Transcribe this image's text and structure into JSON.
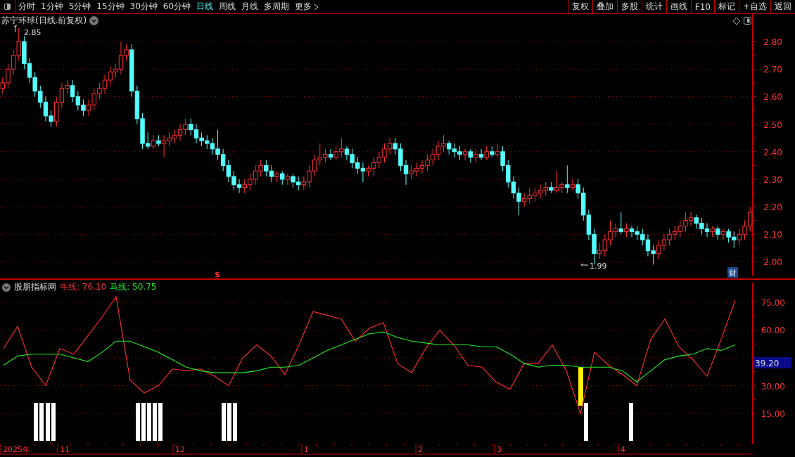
{
  "toolbar": {
    "periods": [
      {
        "label": "分时",
        "selected": false
      },
      {
        "label": "1分钟",
        "selected": false
      },
      {
        "label": "5分钟",
        "selected": false
      },
      {
        "label": "15分钟",
        "selected": false
      },
      {
        "label": "30分钟",
        "selected": false
      },
      {
        "label": "60分钟",
        "selected": false
      },
      {
        "label": "日线",
        "selected": true
      },
      {
        "label": "周线",
        "selected": false
      },
      {
        "label": "月线",
        "selected": false
      },
      {
        "label": "多周期",
        "selected": false
      },
      {
        "label": "更多",
        "selected": false
      }
    ],
    "actions": [
      "复权",
      "叠加",
      "多股",
      "统计",
      "画线",
      "F10",
      "标记",
      "+自选",
      "返回"
    ]
  },
  "price_chart": {
    "title": "苏宁环球(日线.前复权)",
    "high_marker": "2.85",
    "low_marker": "1.99",
    "event_marker": "$",
    "finance_badge": "财",
    "chart_data": {
      "type": "candlestick",
      "categories": [
        null,
        null,
        null,
        null,
        null,
        null,
        null,
        null,
        null,
        null,
        null,
        null,
        null,
        null,
        null,
        null,
        null,
        null,
        null,
        null,
        null,
        null,
        null,
        null,
        null,
        null,
        null,
        null,
        null,
        null,
        null,
        null,
        null,
        null,
        null,
        null,
        null,
        null,
        null,
        null,
        null,
        null,
        null,
        null,
        null,
        null,
        null,
        null,
        null,
        null,
        null,
        null,
        null,
        null,
        null,
        null,
        null,
        null,
        null,
        null,
        null,
        null,
        null,
        null,
        null,
        null,
        null,
        null,
        null,
        null,
        null,
        null,
        null,
        null,
        null,
        null,
        null,
        null,
        null,
        null,
        null,
        null,
        null,
        null,
        null,
        null,
        null,
        null,
        null,
        null,
        null,
        null,
        null,
        null,
        null,
        null,
        null,
        null,
        null,
        null,
        null,
        null,
        null,
        null,
        null,
        null,
        null,
        null,
        null,
        null,
        null,
        null,
        null,
        null,
        null,
        null,
        null,
        null,
        null,
        null,
        null,
        null,
        null,
        null,
        null,
        null,
        null,
        null,
        null,
        null,
        null,
        null,
        null,
        null,
        null,
        null,
        null,
        null,
        null,
        null
      ],
      "ylim": [
        1.95,
        2.9
      ],
      "grid": true,
      "yticks": [
        {
          "value": 2.8,
          "label": "2.80"
        },
        {
          "value": 2.7,
          "label": "2.70"
        },
        {
          "value": 2.6,
          "label": "2.60"
        },
        {
          "value": 2.5,
          "label": "2.50"
        },
        {
          "value": 2.4,
          "label": "2.40"
        },
        {
          "value": 2.3,
          "label": "2.30"
        },
        {
          "value": 2.2,
          "label": "2.20"
        },
        {
          "value": 2.1,
          "label": "2.10"
        },
        {
          "value": 2.0,
          "label": "2.00"
        }
      ],
      "ohlc": [
        [
          2.63,
          2.67,
          2.61,
          2.65
        ],
        [
          2.65,
          2.72,
          2.63,
          2.7
        ],
        [
          2.7,
          2.77,
          2.68,
          2.75
        ],
        [
          2.75,
          2.85,
          2.73,
          2.8
        ],
        [
          2.8,
          2.82,
          2.7,
          2.72
        ],
        [
          2.72,
          2.74,
          2.65,
          2.67
        ],
        [
          2.67,
          2.69,
          2.6,
          2.62
        ],
        [
          2.62,
          2.64,
          2.56,
          2.58
        ],
        [
          2.58,
          2.6,
          2.51,
          2.53
        ],
        [
          2.53,
          2.55,
          2.49,
          2.51
        ],
        [
          2.51,
          2.6,
          2.49,
          2.58
        ],
        [
          2.58,
          2.65,
          2.56,
          2.63
        ],
        [
          2.63,
          2.66,
          2.61,
          2.64
        ],
        [
          2.64,
          2.66,
          2.58,
          2.6
        ],
        [
          2.6,
          2.62,
          2.55,
          2.57
        ],
        [
          2.57,
          2.59,
          2.53,
          2.55
        ],
        [
          2.55,
          2.59,
          2.53,
          2.57
        ],
        [
          2.57,
          2.63,
          2.55,
          2.61
        ],
        [
          2.61,
          2.65,
          2.59,
          2.63
        ],
        [
          2.63,
          2.68,
          2.61,
          2.66
        ],
        [
          2.66,
          2.71,
          2.64,
          2.69
        ],
        [
          2.69,
          2.72,
          2.67,
          2.7
        ],
        [
          2.7,
          2.8,
          2.68,
          2.75
        ],
        [
          2.75,
          2.79,
          2.73,
          2.77
        ],
        [
          2.77,
          2.79,
          2.6,
          2.62
        ],
        [
          2.62,
          2.64,
          2.5,
          2.52
        ],
        [
          2.52,
          2.54,
          2.41,
          2.43
        ],
        [
          2.43,
          2.47,
          2.41,
          2.42
        ],
        [
          2.42,
          2.46,
          2.41,
          2.44
        ],
        [
          2.44,
          2.46,
          2.42,
          2.43
        ],
        [
          2.43,
          2.46,
          2.38,
          2.44
        ],
        [
          2.44,
          2.47,
          2.42,
          2.45
        ],
        [
          2.45,
          2.48,
          2.43,
          2.46
        ],
        [
          2.46,
          2.5,
          2.44,
          2.48
        ],
        [
          2.48,
          2.52,
          2.46,
          2.5
        ],
        [
          2.5,
          2.52,
          2.46,
          2.48
        ],
        [
          2.48,
          2.5,
          2.43,
          2.45
        ],
        [
          2.45,
          2.47,
          2.42,
          2.44
        ],
        [
          2.44,
          2.46,
          2.41,
          2.43
        ],
        [
          2.43,
          2.45,
          2.39,
          2.41
        ],
        [
          2.41,
          2.48,
          2.37,
          2.39
        ],
        [
          2.39,
          2.41,
          2.33,
          2.35
        ],
        [
          2.35,
          2.37,
          2.29,
          2.31
        ],
        [
          2.31,
          2.33,
          2.26,
          2.28
        ],
        [
          2.28,
          2.3,
          2.25,
          2.27
        ],
        [
          2.27,
          2.3,
          2.25,
          2.28
        ],
        [
          2.28,
          2.32,
          2.26,
          2.3
        ],
        [
          2.3,
          2.35,
          2.28,
          2.33
        ],
        [
          2.33,
          2.37,
          2.31,
          2.35
        ],
        [
          2.35,
          2.37,
          2.31,
          2.33
        ],
        [
          2.33,
          2.35,
          2.29,
          2.31
        ],
        [
          2.31,
          2.33,
          2.29,
          2.32
        ],
        [
          2.32,
          2.33,
          2.28,
          2.3
        ],
        [
          2.3,
          2.32,
          2.28,
          2.31
        ],
        [
          2.31,
          2.32,
          2.27,
          2.29
        ],
        [
          2.29,
          2.31,
          2.26,
          2.28
        ],
        [
          2.28,
          2.31,
          2.26,
          2.29
        ],
        [
          2.29,
          2.35,
          2.27,
          2.33
        ],
        [
          2.33,
          2.39,
          2.31,
          2.37
        ],
        [
          2.37,
          2.43,
          2.35,
          2.38
        ],
        [
          2.38,
          2.41,
          2.36,
          2.39
        ],
        [
          2.39,
          2.41,
          2.37,
          2.38
        ],
        [
          2.38,
          2.42,
          2.37,
          2.4
        ],
        [
          2.4,
          2.45,
          2.38,
          2.41
        ],
        [
          2.41,
          2.42,
          2.37,
          2.39
        ],
        [
          2.39,
          2.41,
          2.34,
          2.36
        ],
        [
          2.36,
          2.38,
          2.32,
          2.34
        ],
        [
          2.34,
          2.36,
          2.29,
          2.33
        ],
        [
          2.33,
          2.35,
          2.31,
          2.34
        ],
        [
          2.34,
          2.38,
          2.31,
          2.36
        ],
        [
          2.36,
          2.4,
          2.34,
          2.38
        ],
        [
          2.38,
          2.43,
          2.36,
          2.41
        ],
        [
          2.41,
          2.45,
          2.39,
          2.43
        ],
        [
          2.43,
          2.45,
          2.39,
          2.41
        ],
        [
          2.41,
          2.43,
          2.33,
          2.35
        ],
        [
          2.35,
          2.37,
          2.28,
          2.32
        ],
        [
          2.32,
          2.35,
          2.3,
          2.33
        ],
        [
          2.33,
          2.36,
          2.31,
          2.34
        ],
        [
          2.34,
          2.37,
          2.32,
          2.35
        ],
        [
          2.35,
          2.39,
          2.33,
          2.37
        ],
        [
          2.37,
          2.41,
          2.35,
          2.39
        ],
        [
          2.39,
          2.44,
          2.37,
          2.42
        ],
        [
          2.42,
          2.46,
          2.4,
          2.43
        ],
        [
          2.43,
          2.44,
          2.39,
          2.41
        ],
        [
          2.41,
          2.43,
          2.38,
          2.4
        ],
        [
          2.4,
          2.42,
          2.37,
          2.39
        ],
        [
          2.39,
          2.41,
          2.37,
          2.4
        ],
        [
          2.4,
          2.41,
          2.36,
          2.38
        ],
        [
          2.38,
          2.41,
          2.36,
          2.39
        ],
        [
          2.39,
          2.41,
          2.37,
          2.38
        ],
        [
          2.38,
          2.42,
          2.37,
          2.4
        ],
        [
          2.4,
          2.42,
          2.38,
          2.39
        ],
        [
          2.39,
          2.43,
          2.38,
          2.4
        ],
        [
          2.4,
          2.42,
          2.33,
          2.35
        ],
        [
          2.35,
          2.37,
          2.27,
          2.29
        ],
        [
          2.29,
          2.31,
          2.23,
          2.25
        ],
        [
          2.25,
          2.27,
          2.17,
          2.22
        ],
        [
          2.22,
          2.25,
          2.2,
          2.23
        ],
        [
          2.23,
          2.27,
          2.21,
          2.24
        ],
        [
          2.24,
          2.27,
          2.22,
          2.25
        ],
        [
          2.25,
          2.28,
          2.23,
          2.26
        ],
        [
          2.26,
          2.29,
          2.24,
          2.27
        ],
        [
          2.27,
          2.29,
          2.25,
          2.26
        ],
        [
          2.26,
          2.33,
          2.25,
          2.27
        ],
        [
          2.27,
          2.29,
          2.25,
          2.28
        ],
        [
          2.28,
          2.35,
          2.25,
          2.27
        ],
        [
          2.27,
          2.3,
          2.26,
          2.28
        ],
        [
          2.28,
          2.3,
          2.23,
          2.25
        ],
        [
          2.25,
          2.27,
          2.15,
          2.17
        ],
        [
          2.17,
          2.19,
          2.08,
          2.1
        ],
        [
          2.1,
          2.12,
          1.99,
          2.03
        ],
        [
          2.03,
          2.07,
          2.01,
          2.04
        ],
        [
          2.04,
          2.1,
          2.02,
          2.08
        ],
        [
          2.08,
          2.15,
          2.06,
          2.11
        ],
        [
          2.11,
          2.14,
          2.09,
          2.12
        ],
        [
          2.12,
          2.18,
          2.1,
          2.11
        ],
        [
          2.11,
          2.14,
          2.09,
          2.12
        ],
        [
          2.12,
          2.13,
          2.09,
          2.11
        ],
        [
          2.11,
          2.13,
          2.08,
          2.1
        ],
        [
          2.1,
          2.12,
          2.06,
          2.08
        ],
        [
          2.08,
          2.1,
          2.02,
          2.04
        ],
        [
          2.04,
          2.06,
          1.99,
          2.03
        ],
        [
          2.03,
          2.08,
          2.01,
          2.06
        ],
        [
          2.06,
          2.1,
          2.04,
          2.08
        ],
        [
          2.08,
          2.12,
          2.06,
          2.1
        ],
        [
          2.1,
          2.13,
          2.08,
          2.11
        ],
        [
          2.11,
          2.15,
          2.09,
          2.13
        ],
        [
          2.13,
          2.18,
          2.11,
          2.15
        ],
        [
          2.15,
          2.18,
          2.13,
          2.16
        ],
        [
          2.16,
          2.17,
          2.12,
          2.14
        ],
        [
          2.14,
          2.16,
          2.1,
          2.12
        ],
        [
          2.12,
          2.14,
          2.09,
          2.11
        ],
        [
          2.11,
          2.13,
          2.09,
          2.12
        ],
        [
          2.12,
          2.13,
          2.08,
          2.1
        ],
        [
          2.1,
          2.12,
          2.08,
          2.11
        ],
        [
          2.11,
          2.12,
          2.07,
          2.09
        ],
        [
          2.09,
          2.11,
          2.05,
          2.08
        ],
        [
          2.08,
          2.12,
          2.06,
          2.1
        ],
        [
          2.1,
          2.15,
          2.08,
          2.13
        ],
        [
          2.13,
          2.2,
          2.11,
          2.18
        ]
      ]
    }
  },
  "indicator": {
    "name": "股朋指标网",
    "legend": [
      {
        "separator": ":",
        "value": "76.10"
      },
      {
        "separator": ":",
        "value": "50.75"
      }
    ],
    "current_value": "39.20",
    "chart_data": {
      "type": "line",
      "ylim": [
        -1.3,
        85.6
      ],
      "grid": true,
      "yticks": [
        {
          "value": 15,
          "label": "15.00"
        },
        {
          "value": 30,
          "label": "30.00"
        },
        {
          "value": 60,
          "label": "60.00"
        },
        {
          "value": 75,
          "label": "75.00"
        }
      ],
      "series": [
        {
          "name": "牛线",
          "color": "#ff3030",
          "values": [
            50,
            62,
            40,
            30,
            50,
            47,
            57,
            67,
            78,
            33,
            26,
            30,
            39,
            38,
            39,
            35,
            30,
            45,
            52,
            46,
            36,
            52,
            70,
            68,
            66,
            54,
            61,
            64,
            42,
            37,
            50,
            60,
            52,
            41,
            40,
            32,
            28,
            42,
            42,
            52,
            38,
            15,
            48,
            41,
            36,
            30,
            55,
            66,
            51,
            44,
            35,
            55,
            76
          ]
        },
        {
          "name": "马线",
          "color": "#22ee22",
          "values": [
            41,
            46,
            47,
            47,
            47,
            45,
            43,
            48,
            54,
            54,
            51,
            48,
            44,
            40,
            38,
            37,
            37,
            37,
            38,
            40,
            40,
            41,
            45,
            49,
            52,
            55,
            58,
            59,
            56,
            54,
            53,
            52,
            52,
            52,
            51,
            51,
            47,
            42,
            40,
            41,
            41,
            40,
            40,
            40,
            38,
            32,
            38,
            44,
            46,
            47,
            50,
            49,
            52
          ]
        }
      ]
    }
  },
  "date_axis": [
    "2025年",
    "11",
    "12",
    "1",
    "2",
    "3",
    "4"
  ]
}
